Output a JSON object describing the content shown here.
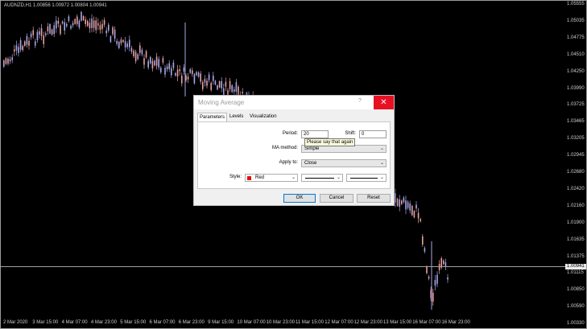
{
  "chart": {
    "title": "AUDNZD,H1  1.00856 1.00972 1.00804 1.00941",
    "current_price": "1.00941",
    "price_labels": [
      "1.05555",
      "1.05035",
      "1.04775",
      "1.04510",
      "1.04250",
      "1.03990",
      "1.03725",
      "1.03465",
      "1.03205",
      "1.02945",
      "1.02680",
      "1.02420",
      "1.02160",
      "1.01900",
      "1.01635",
      "1.01375",
      "1.01115",
      "1.00850",
      "1.00590",
      "1.00330"
    ],
    "time_labels": [
      "2 Mar 2020",
      "3 Mar 15:00",
      "4 Mar 07:00",
      "4 Mar 23:00",
      "5 Mar 15:00",
      "6 Mar 07:00",
      "6 Mar 23:00",
      "9 Mar 15:00",
      "10 Mar 07:00",
      "10 Mar 23:00",
      "11 Mar 15:00",
      "12 Mar 07:00",
      "12 Mar 23:00",
      "13 Mar 15:00",
      "16 Mar 07:00",
      "16 Mar 23:00"
    ],
    "bull_color": "#e8a0a0",
    "bear_color": "#a8a8e8"
  },
  "dialog": {
    "title": "Moving Average",
    "help": "?",
    "close": "✕",
    "tabs": [
      "Parameters",
      "Levels",
      "Visualization"
    ],
    "period_label": "Period:",
    "period_value": "20",
    "shift_label": "Shift:",
    "shift_value": "0",
    "tooltip": "Please say that again",
    "ma_method_label": "MA method:",
    "ma_method_value": "Simple",
    "apply_to_label": "Apply to:",
    "apply_to_value": "Close",
    "style_label": "Style:",
    "style_color_name": "Red",
    "style_color": "#e01010",
    "ok": "OK",
    "cancel": "Cancel",
    "reset": "Reset"
  }
}
